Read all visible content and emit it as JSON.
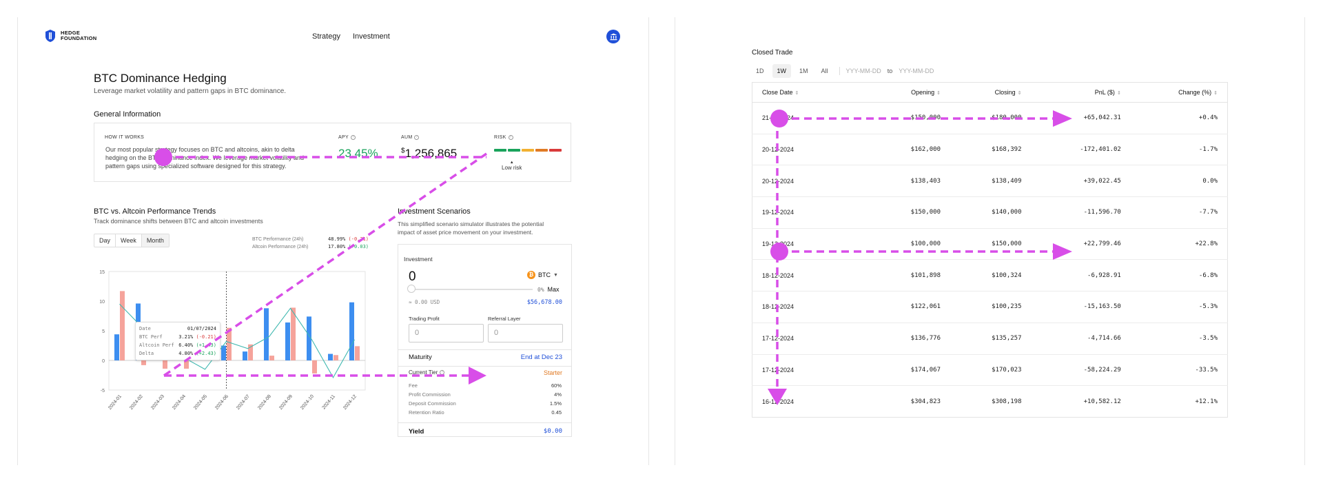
{
  "header": {
    "logo_line1": "HEDGE",
    "logo_line2": "FOUNDATION",
    "nav": [
      "Strategy",
      "Investment"
    ]
  },
  "page": {
    "title": "BTC Dominance Hedging",
    "subtitle": "Leverage market volatility and pattern gaps in BTC dominance."
  },
  "general": {
    "section_title": "General Information",
    "how_label": "HOW IT WORKS",
    "description": "Our most popular strategy focuses on BTC and altcoins, akin to delta hedging on the BTC dominance index. We leverage market volatility and pattern gaps using specialized software designed for this strategy.",
    "apy_label": "APY",
    "apy_value": "23.45%",
    "aum_label": "AUM",
    "aum_currency": "$",
    "aum_value": "1,256,865",
    "risk_label": "RISK",
    "risk_text": "Low risk",
    "risk_colors": [
      "#1aa35c",
      "#1aa35c",
      "#f2b132",
      "#e07a24",
      "#d93a3a"
    ]
  },
  "performance": {
    "title": "BTC vs. Altcoin Performance Trends",
    "subtitle": "Track dominance shifts between BTC and altcoin investments",
    "tabs": [
      "Day",
      "Week",
      "Month"
    ],
    "btc_label": "BTC Performance (24h)",
    "btc_value": "48.99%",
    "btc_change": "(-0.21)",
    "alt_label": "Altcoin Performance (24h)",
    "alt_value": "17.80%",
    "alt_change": "(+0.03)",
    "tooltip": {
      "date_label": "Date",
      "date": "01/07/2024",
      "btc_label": "BTC Perf",
      "btc": "3.21%",
      "btc_ch": "(-0.21)",
      "alt_label": "Altcoin Perf",
      "alt": "6.40%",
      "alt_ch": "(+1.43)",
      "delta_label": "Delta",
      "delta": "4.80%",
      "delta_ch": "(+2.43)"
    }
  },
  "chart_data": {
    "type": "bar",
    "categories": [
      "2024-01",
      "2024-02",
      "2024-03",
      "2024-04",
      "2024-05",
      "2024-06",
      "2024-07",
      "2024-08",
      "2024-09",
      "2024-10",
      "2024-11",
      "2024-12"
    ],
    "y_ticks": [
      15,
      10,
      5,
      0,
      -5
    ],
    "ylim": [
      -5,
      15
    ],
    "series": [
      {
        "values": [
          4.4,
          9.6,
          2.4,
          2.6,
          2.4,
          2.5,
          1.5,
          8.8,
          6.4,
          7.4,
          1.1,
          9.8
        ],
        "color": "#3d8ef0"
      },
      {
        "values": [
          11.7,
          -0.8,
          -1.4,
          -1.4,
          1.4,
          5.5,
          2.7,
          0.8,
          8.9,
          -2.2,
          0.9,
          2.4
        ],
        "color": "#f5a39b"
      },
      {
        "values": [
          9.5,
          5.8,
          2.0,
          0.5,
          -1.5,
          3.2,
          2.0,
          4.0,
          8.8,
          3.5,
          -2.9,
          3.5
        ],
        "color": "#3fb8b0",
        "kind": "line"
      }
    ],
    "highlight_index": 5,
    "grid": false
  },
  "simulator": {
    "title": "Investment Scenarios",
    "description": "This simplified scenario simulator illustrates the potential impact of asset price movement on your investment.",
    "investment_label": "Investment",
    "investment_value": "0",
    "asset": "BTC",
    "asset_glyph": "₿",
    "slider_pct": "0%",
    "max_label": "Max",
    "usd_equiv": "≈ 0.00 USD",
    "balance": "$56,678.00",
    "trading_profit_label": "Trading Profit",
    "trading_profit_value": "0",
    "referral_label": "Referral Layer",
    "referral_value": "0",
    "maturity_label": "Maturity",
    "maturity_value": "End at Dec 23",
    "tier_label": "Current Tier",
    "tier_value": "Starter",
    "fees": [
      {
        "label": "Fee",
        "value": "60%"
      },
      {
        "label": "Profit Commission",
        "value": "4%"
      },
      {
        "label": "Deposit Commission",
        "value": "1.5%"
      },
      {
        "label": "Retention Ratio",
        "value": "0.45"
      }
    ],
    "yield_label": "Yield",
    "yield_value": "$0.00"
  },
  "closed_trade": {
    "title": "Closed Trade",
    "periods": [
      "1D",
      "1W",
      "1M",
      "All"
    ],
    "active_period": "1W",
    "from_placeholder": "YYY-MM-DD",
    "to_label": "to",
    "to_placeholder": "YYY-MM-DD",
    "columns": [
      "Close Date",
      "Opening",
      "Closing",
      "PnL ($)",
      "Change (%)"
    ],
    "rows": [
      {
        "date": "21-12-2024",
        "opening": "$150,000",
        "closing": "$180,000",
        "pnl": "+65,042.31",
        "change": "+0.4%",
        "dir": "pos"
      },
      {
        "date": "20-12-2024",
        "opening": "$162,000",
        "closing": "$168,392",
        "pnl": "-172,401.02",
        "change": "-1.7%",
        "dir": "neg"
      },
      {
        "date": "20-12-2024",
        "opening": "$138,403",
        "closing": "$138,409",
        "pnl": "+39,022.45",
        "change": "0.0%",
        "dir": "pos"
      },
      {
        "date": "19-12-2024",
        "opening": "$150,000",
        "closing": "$140,000",
        "pnl": "-11,596.70",
        "change": "-7.7%",
        "dir": "neg"
      },
      {
        "date": "19-12-2024",
        "opening": "$100,000",
        "closing": "$150,000",
        "pnl": "+22,799.46",
        "change": "+22.8%",
        "dir": "pos"
      },
      {
        "date": "18-12-2024",
        "opening": "$101,898",
        "closing": "$100,324",
        "pnl": "-6,928.91",
        "change": "-6.8%",
        "dir": "neg"
      },
      {
        "date": "18-12-2024",
        "opening": "$122,061",
        "closing": "$100,235",
        "pnl": "-15,163.50",
        "change": "-5.3%",
        "dir": "neg"
      },
      {
        "date": "17-12-2024",
        "opening": "$136,776",
        "closing": "$135,257",
        "pnl": "-4,714.66",
        "change": "-3.5%",
        "dir": "neg"
      },
      {
        "date": "17-12-2024",
        "opening": "$174,067",
        "closing": "$170,023",
        "pnl": "-58,224.29",
        "change": "-33.5%",
        "dir": "neg"
      },
      {
        "date": "16-12-2024",
        "opening": "$304,823",
        "closing": "$308,198",
        "pnl": "+10,582.12",
        "change": "+12.1%",
        "dir": "pos"
      }
    ]
  },
  "colors": {
    "brand": "#1f4fd8",
    "positive": "#1aa35c",
    "negative": "#d93a3a",
    "annotation": "#d84ee8"
  }
}
